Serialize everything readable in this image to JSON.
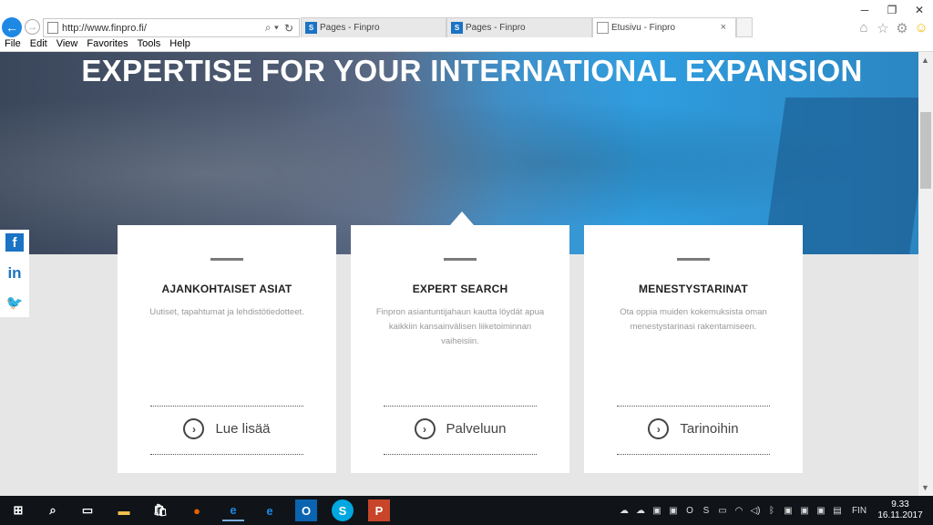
{
  "browser": {
    "url": "http://www.finpro.fi/",
    "tabs": [
      {
        "label": "Pages - Finpro",
        "icon": "sharepoint-icon"
      },
      {
        "label": "Pages - Finpro",
        "icon": "sharepoint-icon"
      },
      {
        "label": "Etusivu - Finpro",
        "icon": "page-icon",
        "active": true,
        "close": "×"
      }
    ],
    "menu": [
      "File",
      "Edit",
      "View",
      "Favorites",
      "Tools",
      "Help"
    ]
  },
  "hero": {
    "title": "EXPERTISE FOR YOUR INTERNATIONAL EXPANSION"
  },
  "cards": [
    {
      "title": "AJANKOHTAISET ASIAT",
      "desc": "Uutiset, tapahtumat ja lehdistötiedotteet.",
      "link": "Lue lisää"
    },
    {
      "title": "EXPERT SEARCH",
      "desc": "Finpron asiantuntijahaun kautta löydät apua kaikkiin kansainvälisen liiketoiminnan vaiheisiin.",
      "link": "Palveluun"
    },
    {
      "title": "MENESTYSTARINAT",
      "desc": "Ota oppia muiden kokemuksista oman menestystarinasi rakentamiseen.",
      "link": "Tarinoihin"
    }
  ],
  "social": [
    "facebook-icon",
    "linkedin-icon",
    "twitter-icon"
  ],
  "taskbar": {
    "lang": "FIN",
    "time": "9.33",
    "date": "16.11.2017"
  },
  "colors": {
    "accent": "#1b73c4",
    "back_button": "#1e88e5",
    "taskbar": "#101418"
  }
}
